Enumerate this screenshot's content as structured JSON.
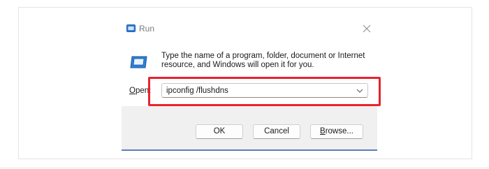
{
  "dialog": {
    "title": "Run",
    "app_icon": "run-icon",
    "close_icon": "close-icon",
    "description": "Type the name of a program, folder, document or Internet\nresource, and Windows will open it for you.",
    "open_label_first": "O",
    "open_label_rest": "pen:",
    "command_value": "ipconfig /flushdns",
    "dropdown_icon": "chevron-down-icon",
    "ok_label": "OK",
    "cancel_label": "Cancel",
    "browse_label_first": "B",
    "browse_label_rest": "rowse...",
    "highlight_color": "#e8232f",
    "accent_color": "#5b7fb8"
  }
}
